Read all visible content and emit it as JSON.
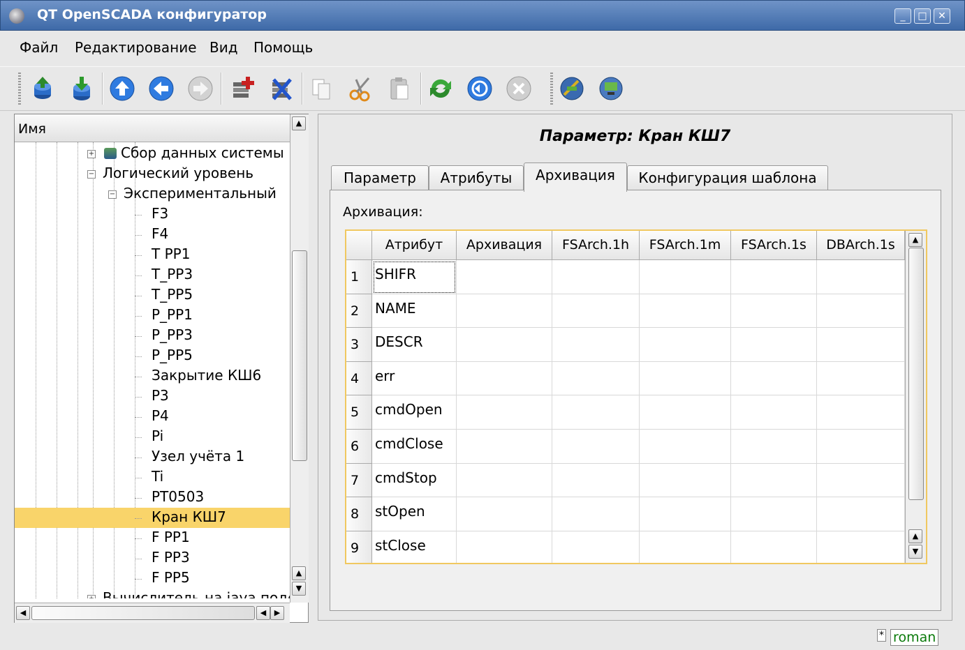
{
  "window": {
    "title": "QT OpenSCADA конфигуратор",
    "buttons": [
      "_",
      "□",
      "✕"
    ]
  },
  "menu": [
    {
      "label": "Файл"
    },
    {
      "label": "Редактирование"
    },
    {
      "label": "Вид"
    },
    {
      "label": "Помощь"
    }
  ],
  "toolbar": {
    "icons": [
      "db-load-icon",
      "db-save-icon",
      "up-icon",
      "back-icon",
      "forward-icon",
      "add-item-icon",
      "delete-item-icon",
      "copy-icon",
      "cut-icon",
      "paste-icon",
      "refresh-icon",
      "start-icon",
      "stop-icon",
      "remote-station-icon",
      "remote-host-icon"
    ]
  },
  "tree": {
    "header": "Имя",
    "items": [
      {
        "label": "Сбор данных системы",
        "level": 3,
        "expander": "+"
      },
      {
        "label": "Логический уровень",
        "level": 3,
        "expander": "−"
      },
      {
        "label": "Экспериментальный",
        "level": 4,
        "expander": "−"
      },
      {
        "label": "F3",
        "level": 5
      },
      {
        "label": "F4",
        "level": 5
      },
      {
        "label": "T PP1",
        "level": 5
      },
      {
        "label": "T_PP3",
        "level": 5
      },
      {
        "label": "T_PP5",
        "level": 5
      },
      {
        "label": "P_PP1",
        "level": 5
      },
      {
        "label": "P_PP3",
        "level": 5
      },
      {
        "label": "P_PP5",
        "level": 5
      },
      {
        "label": "Закрытие КШ6",
        "level": 5
      },
      {
        "label": "P3",
        "level": 5
      },
      {
        "label": "P4",
        "level": 5
      },
      {
        "label": "Pi",
        "level": 5
      },
      {
        "label": "Узел учёта 1",
        "level": 5
      },
      {
        "label": "Ti",
        "level": 5
      },
      {
        "label": "PT0503",
        "level": 5
      },
      {
        "label": "Кран КШ7",
        "level": 5,
        "selected": true
      },
      {
        "label": "F PP1",
        "level": 5
      },
      {
        "label": "F PP3",
        "level": 5
      },
      {
        "label": "F PP5",
        "level": 5
      },
      {
        "label": "Вычислитель на java подоб",
        "level": 3,
        "expander": "+"
      }
    ]
  },
  "panel": {
    "title": "Параметр: Кран КШ7",
    "tabs": [
      {
        "label": "Параметр"
      },
      {
        "label": "Атрибуты"
      },
      {
        "label": "Архивация",
        "active": true
      },
      {
        "label": "Конфигурация шаблона"
      }
    ],
    "section_label": "Архивация:",
    "table": {
      "columns": [
        "Атрибут",
        "Архивация",
        "FSArch.1h",
        "FSArch.1m",
        "FSArch.1s",
        "DBArch.1s"
      ],
      "rows": [
        {
          "num": "1",
          "attr": "SHIFR"
        },
        {
          "num": "2",
          "attr": "NAME"
        },
        {
          "num": "3",
          "attr": "DESCR"
        },
        {
          "num": "4",
          "attr": "err"
        },
        {
          "num": "5",
          "attr": "cmdOpen"
        },
        {
          "num": "6",
          "attr": "cmdClose"
        },
        {
          "num": "7",
          "attr": "cmdStop"
        },
        {
          "num": "8",
          "attr": "stOpen"
        },
        {
          "num": "9",
          "attr": "stClose"
        }
      ]
    }
  },
  "status": {
    "modified": "*",
    "user": "roman"
  },
  "colors": {
    "selection": "#f9d46a",
    "grid_focus": "#f0c860",
    "user": "#0a7a0a"
  }
}
